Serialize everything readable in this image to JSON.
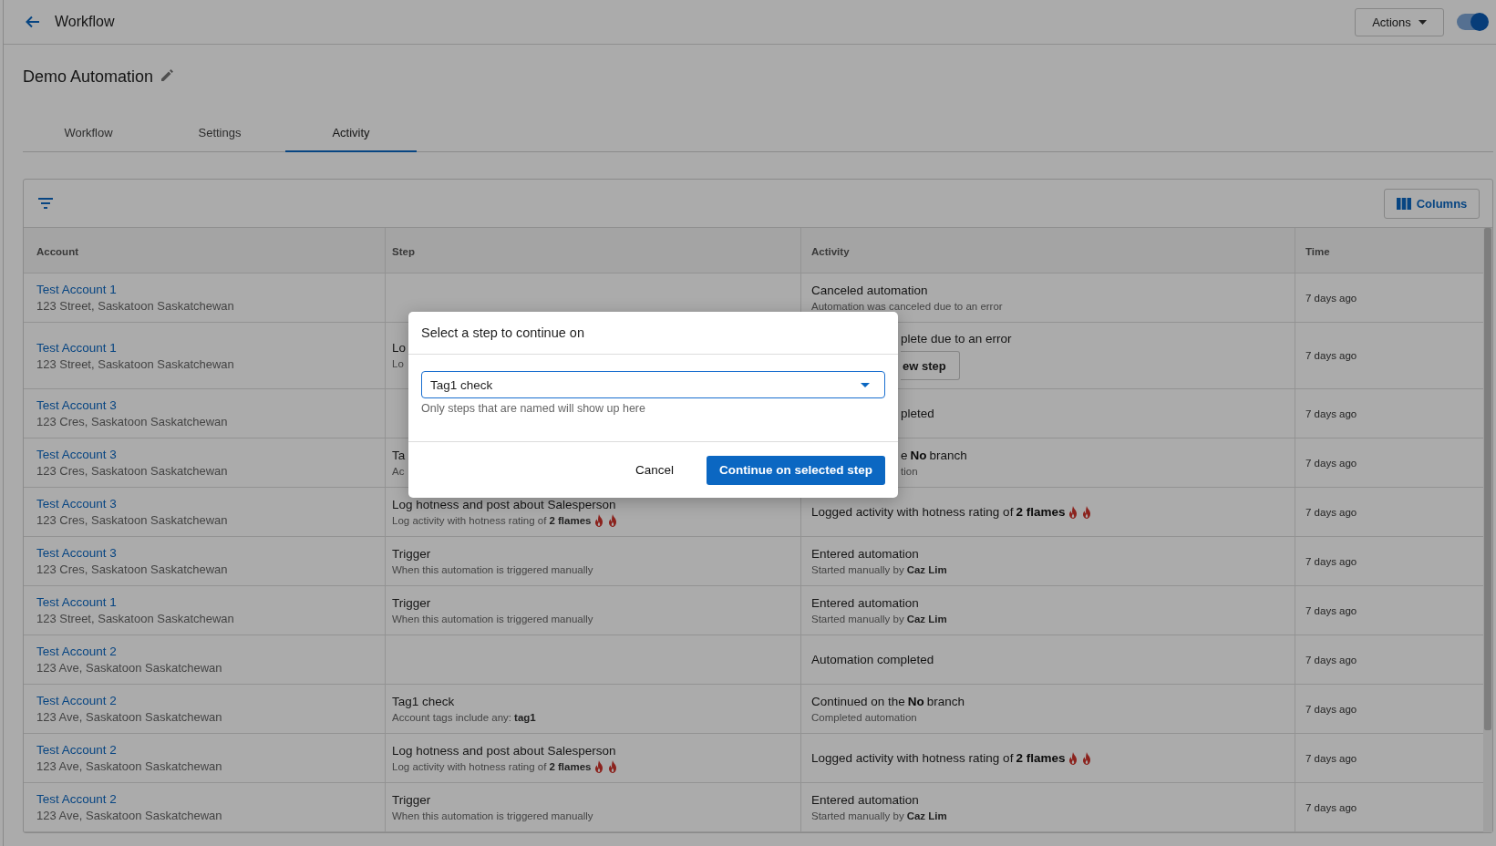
{
  "header": {
    "title": "Workflow",
    "actions_button": "Actions",
    "toggle": {
      "on": true
    }
  },
  "automation": {
    "name": "Demo Automation"
  },
  "tabs": [
    {
      "label": "Workflow",
      "selected": false
    },
    {
      "label": "Settings",
      "selected": false
    },
    {
      "label": "Activity",
      "selected": true
    }
  ],
  "table": {
    "columns_button": "Columns",
    "columns": [
      "Account",
      "Step",
      "Activity",
      "Time"
    ],
    "rows": [
      {
        "account": {
          "name": "Test Account 1",
          "address": "123 Street, Saskatoon Saskatchewan"
        },
        "activity": {
          "kind": "plain",
          "title": "Canceled automation",
          "detail": "Automation was canceled due to an error"
        },
        "time": "7 days ago"
      },
      {
        "account": {
          "name": "Test Account 1",
          "address": "123 Street, Saskatoon Saskatchewan"
        },
        "step": {
          "title": "Lo",
          "detail": "Lo"
        },
        "activity": {
          "kind": "covered",
          "title": "plete due to an error",
          "button": "ew step"
        },
        "time": "7 days ago"
      },
      {
        "account": {
          "name": "Test Account 3",
          "address": "123 Cres, Saskatoon Saskatchewan"
        },
        "activity": {
          "kind": "covered",
          "title": "pleted"
        },
        "time": "7 days ago"
      },
      {
        "account": {
          "name": "Test Account 3",
          "address": "123 Cres, Saskatoon Saskatchewan"
        },
        "step": {
          "title": "Ta",
          "detail": "Ac"
        },
        "activity": {
          "kind": "covered",
          "title": "e **No** branch",
          "detail": "tion"
        },
        "time": "7 days ago"
      },
      {
        "account": {
          "name": "Test Account 3",
          "address": "123 Cres, Saskatoon Saskatchewan"
        },
        "step": {
          "title": "Log hotness and post about Salesperson",
          "detail": "Log activity with hotness rating of **2 flames**",
          "icons": [
            {
              "kind": "flame"
            },
            {
              "kind": "flame"
            }
          ]
        },
        "activity": {
          "kind": "plain",
          "title": "Logged activity with hotness rating of **2 flames**",
          "icons": [
            {
              "kind": "flame"
            },
            {
              "kind": "flame"
            }
          ]
        },
        "time": "7 days ago"
      },
      {
        "account": {
          "name": "Test Account 3",
          "address": "123 Cres, Saskatoon Saskatchewan"
        },
        "step": {
          "title": "Trigger",
          "detail": "When this automation is triggered manually"
        },
        "activity": {
          "kind": "plain",
          "title": "Entered automation",
          "detail": "Started manually by **Caz Lim**"
        },
        "time": "7 days ago"
      },
      {
        "account": {
          "name": "Test Account 1",
          "address": "123 Street, Saskatoon Saskatchewan"
        },
        "step": {
          "title": "Trigger",
          "detail": "When this automation is triggered manually"
        },
        "activity": {
          "kind": "plain",
          "title": "Entered automation",
          "detail": "Started manually by **Caz Lim**"
        },
        "time": "7 days ago"
      },
      {
        "account": {
          "name": "Test Account 2",
          "address": "123 Ave, Saskatoon Saskatchewan"
        },
        "activity": {
          "kind": "plain",
          "title": "Automation completed"
        },
        "time": "7 days ago"
      },
      {
        "account": {
          "name": "Test Account 2",
          "address": "123 Ave, Saskatoon Saskatchewan"
        },
        "step": {
          "title": "Tag1 check",
          "detail": "Account tags include any: **tag1**"
        },
        "activity": {
          "kind": "plain",
          "title": "Continued on the **No** branch",
          "detail": "Completed automation"
        },
        "time": "7 days ago"
      },
      {
        "account": {
          "name": "Test Account 2",
          "address": "123 Ave, Saskatoon Saskatchewan"
        },
        "step": {
          "title": "Log hotness and post about Salesperson",
          "detail": "Log activity with hotness rating of **2 flames**",
          "icons": [
            {
              "kind": "flame"
            },
            {
              "kind": "flame"
            }
          ]
        },
        "activity": {
          "kind": "plain",
          "title": "Logged activity with hotness rating of **2 flames**",
          "icons": [
            {
              "kind": "flame"
            },
            {
              "kind": "flame"
            }
          ]
        },
        "time": "7 days ago"
      },
      {
        "account": {
          "name": "Test Account 2",
          "address": "123 Ave, Saskatoon Saskatchewan"
        },
        "step": {
          "title": "Trigger",
          "detail": "When this automation is triggered manually"
        },
        "activity": {
          "kind": "plain",
          "title": "Entered automation",
          "detail": "Started manually by **Caz Lim**"
        },
        "time": "7 days ago"
      }
    ]
  },
  "dialog": {
    "title": "Select a step to continue on",
    "select": {
      "value": "Tag1 check",
      "helper": "Only steps that are named will show up here"
    },
    "buttons": [
      {
        "label": "Cancel",
        "kind": "text"
      },
      {
        "label": "Continue on selected step",
        "kind": "primary"
      }
    ]
  }
}
